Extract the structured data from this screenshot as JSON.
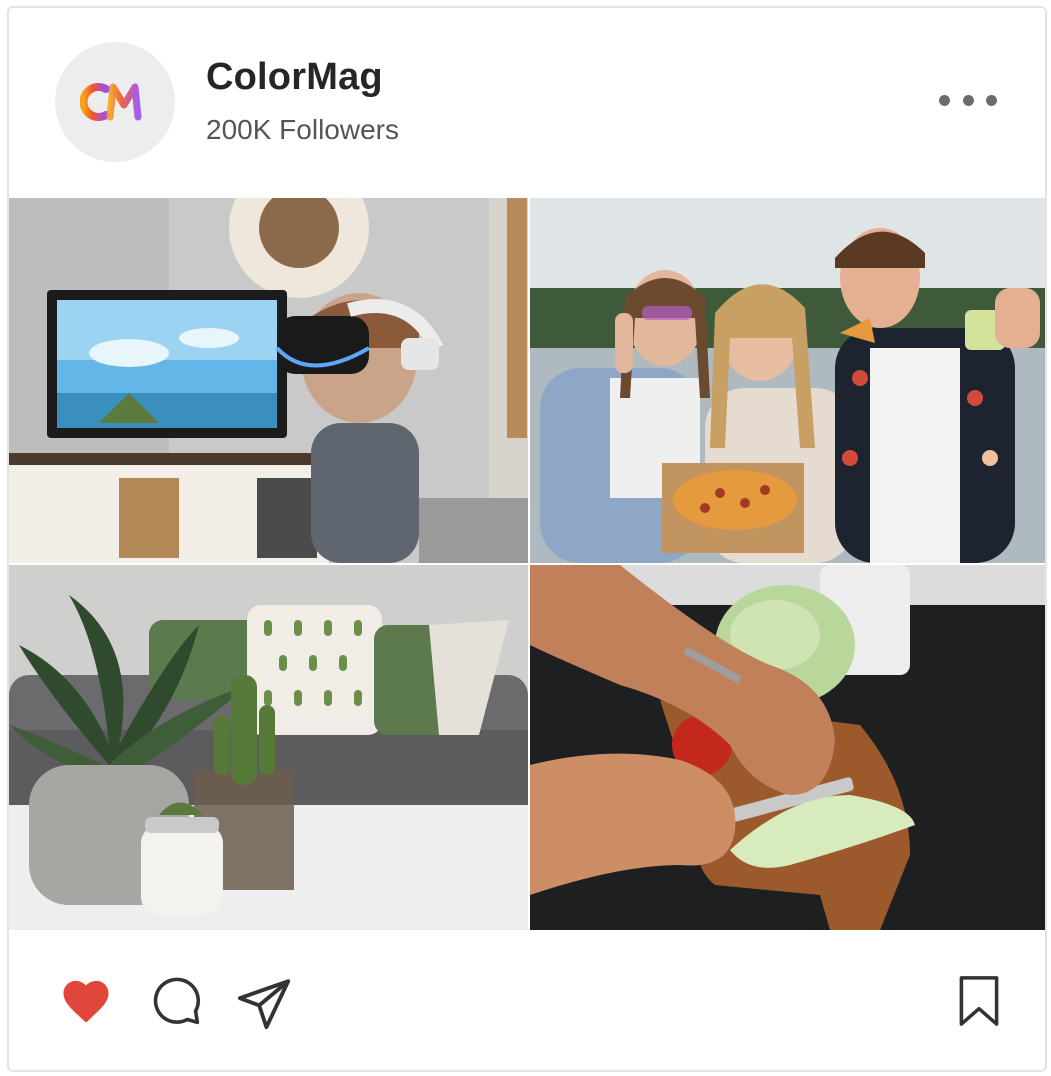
{
  "post": {
    "account": {
      "name": "ColorMag",
      "followers": "200K Followers",
      "avatar_text": "CM",
      "avatar_colors": [
        "#f7a21b",
        "#f0562b",
        "#9b4df2"
      ]
    },
    "menu_icon": "more-horizontal-icon",
    "photos": [
      {
        "subject": "child-with-vr-headset"
      },
      {
        "subject": "friends-with-pizza"
      },
      {
        "subject": "living-room-plants"
      },
      {
        "subject": "chopping-lettuce"
      }
    ],
    "actions": {
      "like_icon": "heart-icon",
      "like_color": "#e2453a",
      "comment_icon": "comment-icon",
      "share_icon": "send-icon",
      "save_icon": "bookmark-icon"
    }
  }
}
